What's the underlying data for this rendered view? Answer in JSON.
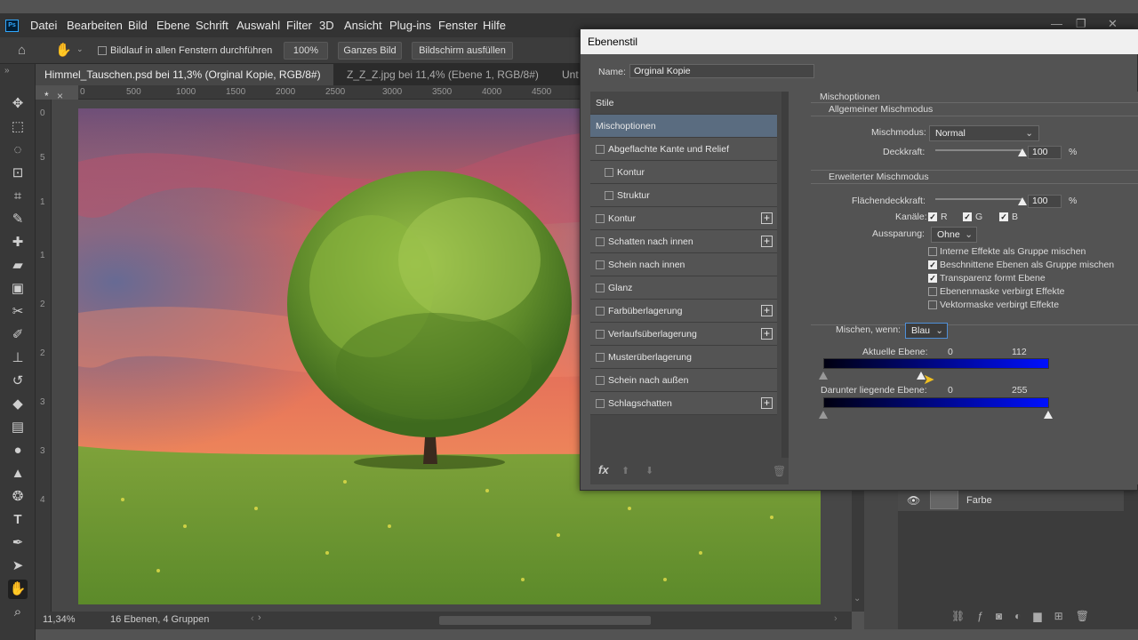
{
  "menubar": {
    "items": [
      "Datei",
      "Bearbeiten",
      "Bild",
      "Ebene",
      "Schrift",
      "Auswahl",
      "Filter",
      "3D",
      "Ansicht",
      "Plug-ins",
      "Fenster",
      "Hilfe"
    ],
    "logo": "Ps"
  },
  "options": {
    "scroll_all_label": "Bildlauf in allen Fenstern durchführen",
    "zoom_100": "100%",
    "fit_screen": "Ganzes Bild",
    "fill_screen": "Bildschirm ausfüllen"
  },
  "tabs": [
    {
      "label": "Himmel_Tauschen.psd bei 11,3% (Orginal Kopie, RGB/8#) *",
      "close": "×"
    },
    {
      "label": "Z_Z_Z.jpg bei 11,4% (Ebene 1, RGB/8#) *",
      "close": "×"
    },
    {
      "label": "Unt"
    }
  ],
  "ruler": {
    "h": [
      "0",
      "500",
      "1000",
      "1500",
      "2000",
      "2500",
      "3000",
      "3500",
      "4000",
      "4500"
    ],
    "v": [
      "0",
      "5",
      "1",
      "1",
      "2",
      "2",
      "3",
      "3",
      "4"
    ]
  },
  "status": {
    "zoom": "11,34%",
    "info": "16 Ebenen, 4 Gruppen"
  },
  "layers": {
    "layer_name": "Farbe"
  },
  "dialog": {
    "title": "Ebenenstil",
    "name_label": "Name:",
    "name_value": "Orginal Kopie",
    "styles": [
      {
        "label": "Stile",
        "checkbox": false,
        "plus": false,
        "indent": 0
      },
      {
        "label": "Mischoptionen",
        "checkbox": false,
        "plus": false,
        "indent": 0,
        "selected": true
      },
      {
        "label": "Abgeflachte Kante und Relief",
        "checkbox": true,
        "plus": false,
        "indent": 0
      },
      {
        "label": "Kontur",
        "checkbox": true,
        "plus": false,
        "indent": 1
      },
      {
        "label": "Struktur",
        "checkbox": true,
        "plus": false,
        "indent": 1
      },
      {
        "label": "Kontur",
        "checkbox": true,
        "plus": true,
        "indent": 0
      },
      {
        "label": "Schatten nach innen",
        "checkbox": true,
        "plus": true,
        "indent": 0
      },
      {
        "label": "Schein nach innen",
        "checkbox": true,
        "plus": false,
        "indent": 0
      },
      {
        "label": "Glanz",
        "checkbox": true,
        "plus": false,
        "indent": 0
      },
      {
        "label": "Farbüberlagerung",
        "checkbox": true,
        "plus": true,
        "indent": 0
      },
      {
        "label": "Verlaufsüberlagerung",
        "checkbox": true,
        "plus": true,
        "indent": 0
      },
      {
        "label": "Musterüberlagerung",
        "checkbox": true,
        "plus": false,
        "indent": 0
      },
      {
        "label": "Schein nach außen",
        "checkbox": true,
        "plus": false,
        "indent": 0
      },
      {
        "label": "Schlagschatten",
        "checkbox": true,
        "plus": true,
        "indent": 0
      }
    ],
    "fx_label": "fx",
    "blend": {
      "section_title": "Mischoptionen",
      "general_title": "Allgemeiner Mischmodus",
      "mode_label": "Mischmodus:",
      "mode_value": "Normal",
      "opacity_label": "Deckkraft:",
      "opacity_value": "100",
      "opacity_unit": "%",
      "opacity_level": 1.0,
      "advanced_title": "Erweiterter Mischmodus",
      "fill_label": "Flächendeckkraft:",
      "fill_value": "100",
      "fill_unit": "%",
      "fill_level": 1.0,
      "channels_label": "Kanäle:",
      "channels": [
        {
          "name": "R",
          "checked": true
        },
        {
          "name": "G",
          "checked": true
        },
        {
          "name": "B",
          "checked": true
        }
      ],
      "knockout_label": "Aussparung:",
      "knockout_value": "Ohne",
      "options": [
        {
          "label": "Interne Effekte als Gruppe mischen",
          "checked": false
        },
        {
          "label": "Beschnittene Ebenen als Gruppe mischen",
          "checked": true
        },
        {
          "label": "Transparenz formt Ebene",
          "checked": true
        },
        {
          "label": "Ebenenmaske verbirgt Effekte",
          "checked": false
        },
        {
          "label": "Vektormaske verbirgt Effekte",
          "checked": false
        }
      ],
      "blendif_label": "Mischen, wenn:",
      "blendif_value": "Blau",
      "this_layer_label": "Aktuelle Ebene:",
      "this_layer_min": "0",
      "this_layer_max": "112",
      "underlying_label": "Darunter liegende Ebene:",
      "underlying_min": "0",
      "underlying_max": "255"
    }
  }
}
